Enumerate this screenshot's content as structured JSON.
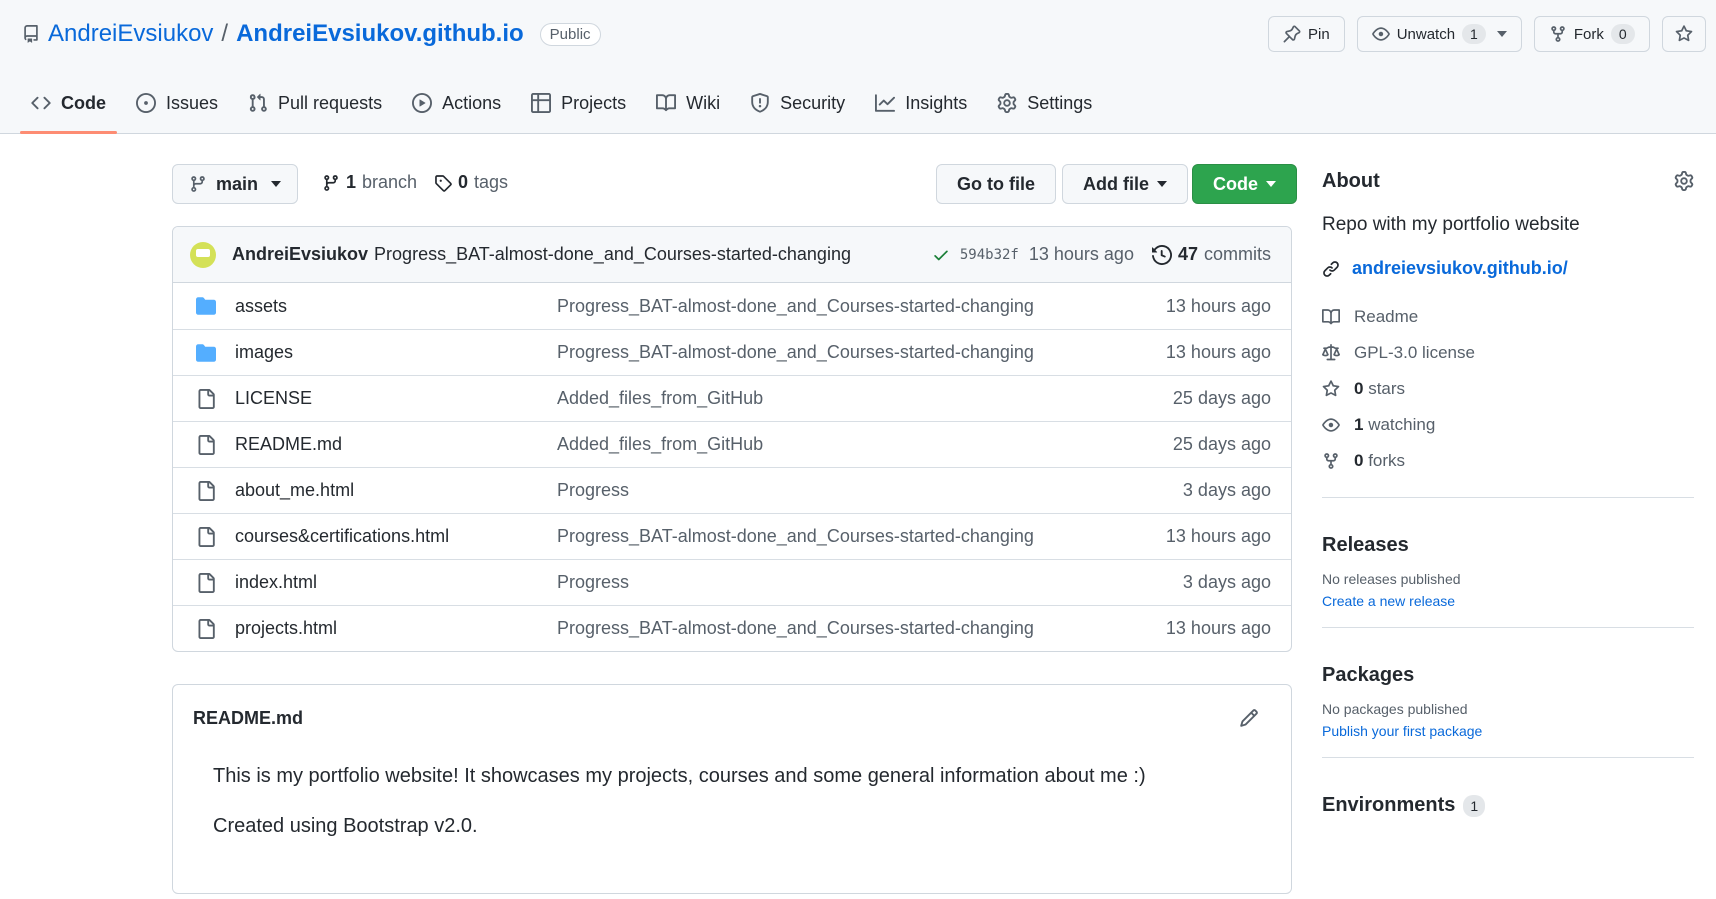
{
  "header": {
    "owner": "AndreiEvsiukov",
    "separator": "/",
    "repo": "AndreiEvsiukov.github.io",
    "visibility": "Public",
    "actions": {
      "pin": "Pin",
      "unwatch": "Unwatch",
      "unwatch_count": "1",
      "fork": "Fork",
      "fork_count": "0"
    }
  },
  "tabs": [
    {
      "label": "Code",
      "icon": "code-icon"
    },
    {
      "label": "Issues",
      "icon": "issue-icon"
    },
    {
      "label": "Pull requests",
      "icon": "pull-request-icon"
    },
    {
      "label": "Actions",
      "icon": "play-icon"
    },
    {
      "label": "Projects",
      "icon": "table-icon"
    },
    {
      "label": "Wiki",
      "icon": "book-icon"
    },
    {
      "label": "Security",
      "icon": "shield-icon"
    },
    {
      "label": "Insights",
      "icon": "graph-icon"
    },
    {
      "label": "Settings",
      "icon": "gear-icon"
    }
  ],
  "toolbar": {
    "branch": "main",
    "branch_count": "1",
    "branch_word": "branch",
    "tag_count": "0",
    "tag_word": "tags",
    "go_to_file": "Go to file",
    "add_file": "Add file",
    "code": "Code"
  },
  "commit": {
    "author": "AndreiEvsiukov",
    "message": "Progress_BAT-almost-done_and_Courses-started-changing",
    "sha": "594b32f",
    "time": "13 hours ago",
    "commit_count": "47",
    "commit_word": "commits"
  },
  "files": [
    {
      "type": "dir",
      "name": "assets",
      "message": "Progress_BAT-almost-done_and_Courses-started-changing",
      "age": "13 hours ago"
    },
    {
      "type": "dir",
      "name": "images",
      "message": "Progress_BAT-almost-done_and_Courses-started-changing",
      "age": "13 hours ago"
    },
    {
      "type": "file",
      "name": "LICENSE",
      "message": "Added_files_from_GitHub",
      "age": "25 days ago"
    },
    {
      "type": "file",
      "name": "README.md",
      "message": "Added_files_from_GitHub",
      "age": "25 days ago"
    },
    {
      "type": "file",
      "name": "about_me.html",
      "message": "Progress",
      "age": "3 days ago"
    },
    {
      "type": "file",
      "name": "courses&certifications.html",
      "message": "Progress_BAT-almost-done_and_Courses-started-changing",
      "age": "13 hours ago"
    },
    {
      "type": "file",
      "name": "index.html",
      "message": "Progress",
      "age": "3 days ago"
    },
    {
      "type": "file",
      "name": "projects.html",
      "message": "Progress_BAT-almost-done_and_Courses-started-changing",
      "age": "13 hours ago"
    }
  ],
  "readme": {
    "filename": "README.md",
    "paragraphs": [
      "This is my portfolio website! It showcases my projects, courses and some general information about me :)",
      "Created using Bootstrap v2.0."
    ]
  },
  "about": {
    "title": "About",
    "description": "Repo with my portfolio website",
    "link": "andreievsiukov.github.io/",
    "readme": "Readme",
    "license": "GPL-3.0 license",
    "stars_count": "0",
    "stars_word": "stars",
    "watching_count": "1",
    "watching_word": "watching",
    "forks_count": "0",
    "forks_word": "forks"
  },
  "releases": {
    "title": "Releases",
    "empty": "No releases published",
    "link": "Create a new release"
  },
  "packages": {
    "title": "Packages",
    "empty": "No packages published",
    "link": "Publish your first package"
  },
  "environments": {
    "title": "Environments",
    "count": "1"
  },
  "colors": {
    "link": "#0969da",
    "primary_button": "#2da44e",
    "tab_underline": "#fd8c73",
    "folder": "#54aeff"
  }
}
